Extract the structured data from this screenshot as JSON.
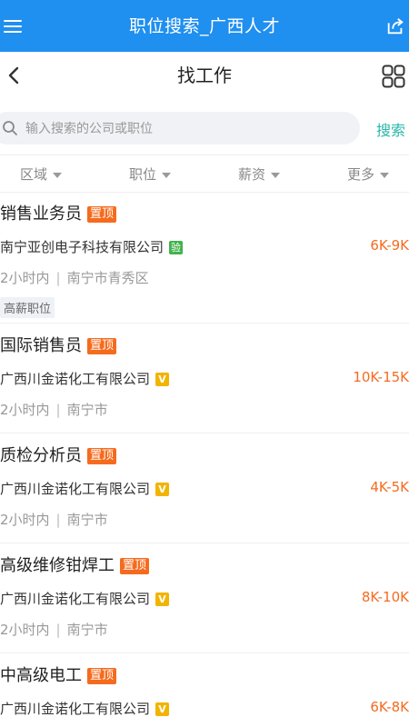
{
  "app": {
    "title": "职位搜索_广西人才"
  },
  "nav": {
    "title": "找工作"
  },
  "search": {
    "placeholder": "输入搜索的公司或职位",
    "button_label": "搜索"
  },
  "filters": [
    {
      "label": "区域"
    },
    {
      "label": "职位"
    },
    {
      "label": "薪资"
    },
    {
      "label": "更多"
    }
  ],
  "colors": {
    "primary": "#1f8ff0",
    "accent": "#f56b1e",
    "search_text": "#29b6a8",
    "verify_badge": "#41b24c",
    "v_badge": "#f2b400"
  },
  "jobs": [
    {
      "title": "销售业务员",
      "pin_label": "置顶",
      "company": "南宁亚创电子科技有限公司",
      "badge_icon": "verify-badge-icon",
      "badge_text": "验",
      "salary": "6K-9K",
      "time": "2小时内",
      "location": "南宁市青秀区",
      "tag": "高薪职位"
    },
    {
      "title": "国际销售员",
      "pin_label": "置顶",
      "company": "广西川金诺化工有限公司",
      "badge_icon": "v-badge-icon",
      "badge_text": "V",
      "salary": "10K-15K",
      "time": "2小时内",
      "location": "南宁市"
    },
    {
      "title": "质检分析员",
      "pin_label": "置顶",
      "company": "广西川金诺化工有限公司",
      "badge_icon": "v-badge-icon",
      "badge_text": "V",
      "salary": "4K-5K",
      "time": "2小时内",
      "location": "南宁市"
    },
    {
      "title": "高级维修钳焊工",
      "pin_label": "置顶",
      "company": "广西川金诺化工有限公司",
      "badge_icon": "v-badge-icon",
      "badge_text": "V",
      "salary": "8K-10K",
      "time": "2小时内",
      "location": "南宁市"
    },
    {
      "title": "中高级电工",
      "pin_label": "置顶",
      "company": "广西川金诺化工有限公司",
      "badge_icon": "v-badge-icon",
      "badge_text": "V",
      "salary": "6K-8K"
    }
  ]
}
